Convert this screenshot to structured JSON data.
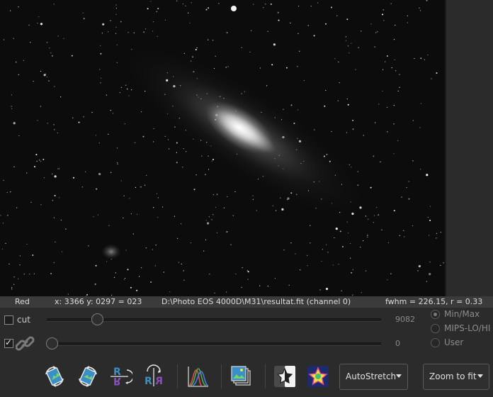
{
  "status": {
    "channel": "Red",
    "coords": "x: 3366 y: 0297 = 023",
    "file": "D:\\Photo EOS 4000D\\M31\\resultat.fit (channel 0)",
    "fwhm": "fwhm = 226.15, r = 0.33"
  },
  "sliders": {
    "cut_label": "cut",
    "cut_checked": false,
    "high_value": "9082",
    "link_checked": true,
    "low_value": "0",
    "high_position": 0.14,
    "low_position": 0.0
  },
  "scale_modes": {
    "options": [
      "Min/Max",
      "MIPS-LO/HI",
      "User"
    ],
    "selected": "Min/Max"
  },
  "toolbar": {
    "icons": [
      "rotate-left-icon",
      "rotate-right-icon",
      "mirror-x-icon",
      "mirror-y-icon",
      "histogram-icon",
      "image-stack-icon",
      "negative-view-icon",
      "color-map-icon"
    ],
    "stretch_label": "AutoStretch",
    "zoom_label": "Zoom to fit"
  }
}
